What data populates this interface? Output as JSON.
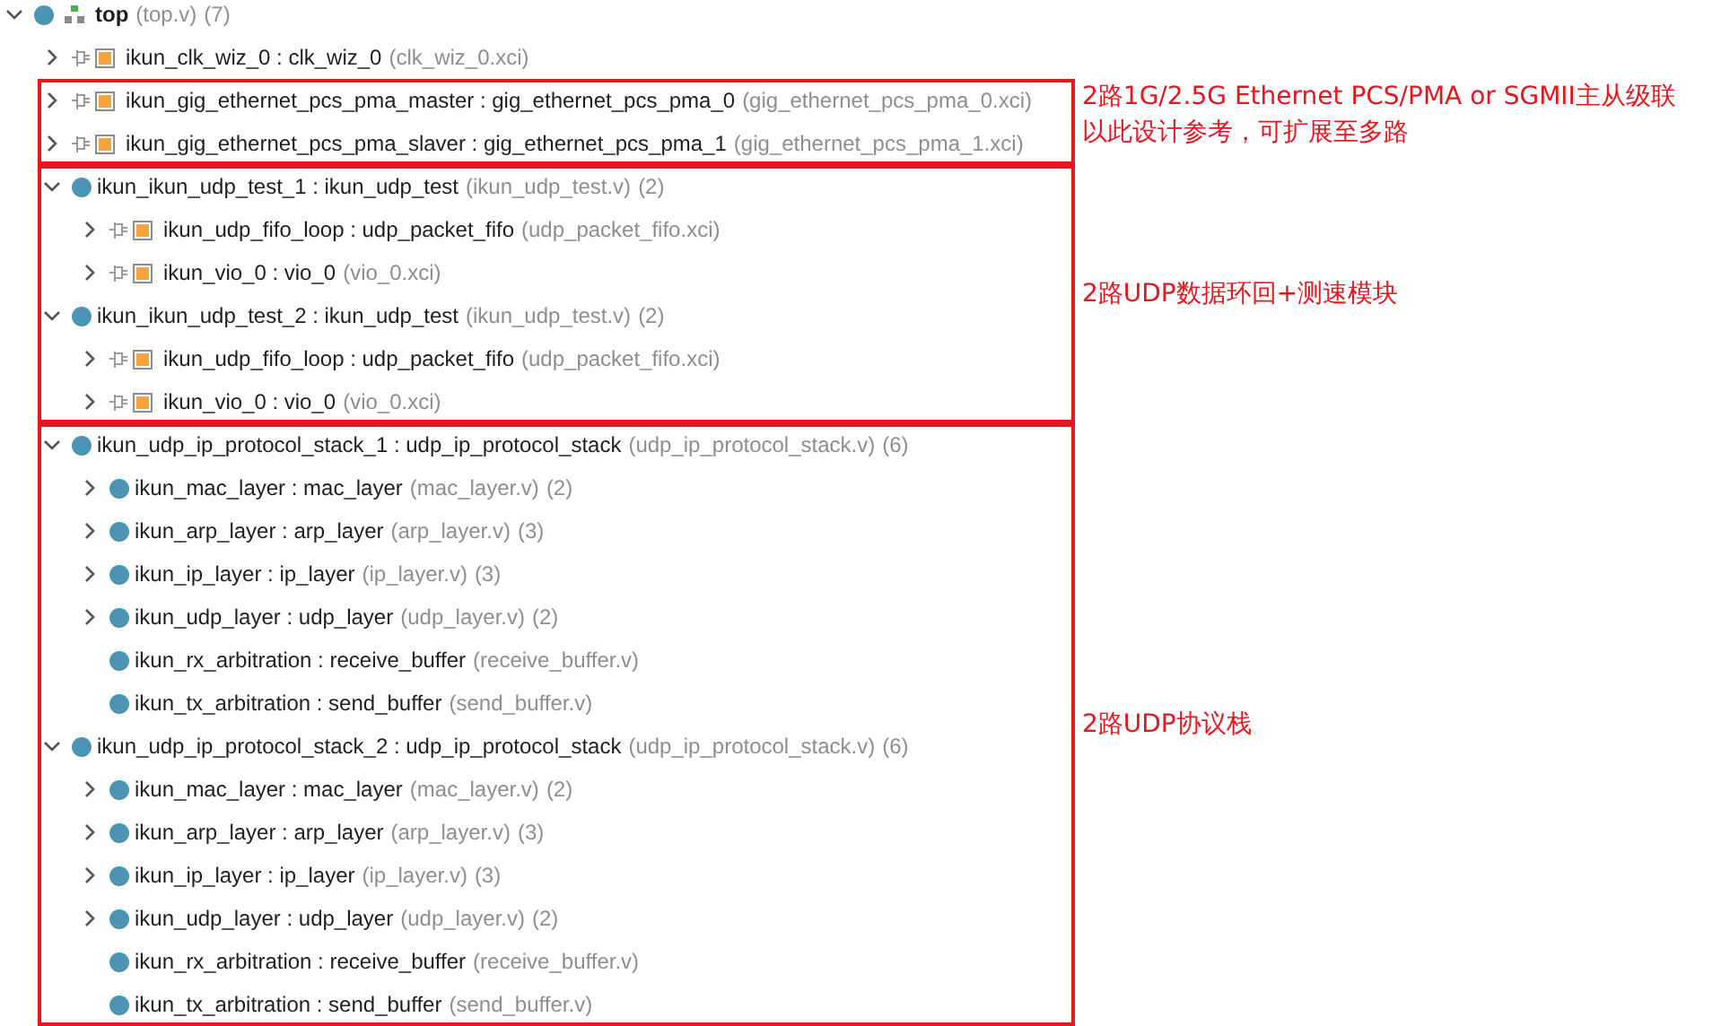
{
  "tree": {
    "kind": "module",
    "label": "top",
    "source": "(top.v)",
    "count": "(7)",
    "expanded": true,
    "groups": [
      {
        "nodes": [
          {
            "kind": "ip",
            "label": "ikun_clk_wiz_0 : clk_wiz_0",
            "source": "(clk_wiz_0.xci)",
            "expanded": false
          }
        ]
      },
      {
        "annotation": [
          "2路1G/2.5G Ethernet PCS/PMA or SGMII主从级联",
          "以此设计参考，可扩展至多路"
        ],
        "nodes": [
          {
            "kind": "ip",
            "label": "ikun_gig_ethernet_pcs_pma_master : gig_ethernet_pcs_pma_0",
            "source": "(gig_ethernet_pcs_pma_0.xci)",
            "expanded": false
          },
          {
            "kind": "ip",
            "label": "ikun_gig_ethernet_pcs_pma_slaver : gig_ethernet_pcs_pma_1",
            "source": "(gig_ethernet_pcs_pma_1.xci)",
            "expanded": false
          }
        ]
      },
      {
        "annotation": [
          "2路UDP数据环回+测速模块"
        ],
        "nodes": [
          {
            "kind": "module",
            "label": "ikun_ikun_udp_test_1 : ikun_udp_test",
            "source": "(ikun_udp_test.v)",
            "count": "(2)",
            "expanded": true,
            "children": [
              {
                "kind": "ip",
                "label": "ikun_udp_fifo_loop : udp_packet_fifo",
                "source": "(udp_packet_fifo.xci)",
                "expanded": false
              },
              {
                "kind": "ip",
                "label": "ikun_vio_0 : vio_0",
                "source": "(vio_0.xci)",
                "expanded": false
              }
            ]
          },
          {
            "kind": "module",
            "label": "ikun_ikun_udp_test_2 : ikun_udp_test",
            "source": "(ikun_udp_test.v)",
            "count": "(2)",
            "expanded": true,
            "children": [
              {
                "kind": "ip",
                "label": "ikun_udp_fifo_loop : udp_packet_fifo",
                "source": "(udp_packet_fifo.xci)",
                "expanded": false
              },
              {
                "kind": "ip",
                "label": "ikun_vio_0 : vio_0",
                "source": "(vio_0.xci)",
                "expanded": false
              }
            ]
          }
        ]
      },
      {
        "annotation": [
          "2路UDP协议栈"
        ],
        "nodes": [
          {
            "kind": "module",
            "label": "ikun_udp_ip_protocol_stack_1 : udp_ip_protocol_stack",
            "source": "(udp_ip_protocol_stack.v)",
            "count": "(6)",
            "expanded": true,
            "children": [
              {
                "kind": "module",
                "label": "ikun_mac_layer : mac_layer",
                "source": "(mac_layer.v)",
                "count": "(2)",
                "expanded": false
              },
              {
                "kind": "module",
                "label": "ikun_arp_layer : arp_layer",
                "source": "(arp_layer.v)",
                "count": "(3)",
                "expanded": false
              },
              {
                "kind": "module",
                "label": "ikun_ip_layer : ip_layer",
                "source": "(ip_layer.v)",
                "count": "(3)",
                "expanded": false
              },
              {
                "kind": "module",
                "label": "ikun_udp_layer : udp_layer",
                "source": "(udp_layer.v)",
                "count": "(2)",
                "expanded": false
              },
              {
                "kind": "module",
                "label": "ikun_rx_arbitration : receive_buffer",
                "source": "(receive_buffer.v)"
              },
              {
                "kind": "module",
                "label": "ikun_tx_arbitration : send_buffer",
                "source": "(send_buffer.v)"
              }
            ]
          },
          {
            "kind": "module",
            "label": "ikun_udp_ip_protocol_stack_2 : udp_ip_protocol_stack",
            "source": "(udp_ip_protocol_stack.v)",
            "count": "(6)",
            "expanded": true,
            "children": [
              {
                "kind": "module",
                "label": "ikun_mac_layer : mac_layer",
                "source": "(mac_layer.v)",
                "count": "(2)",
                "expanded": false
              },
              {
                "kind": "module",
                "label": "ikun_arp_layer : arp_layer",
                "source": "(arp_layer.v)",
                "count": "(3)",
                "expanded": false
              },
              {
                "kind": "module",
                "label": "ikun_ip_layer : ip_layer",
                "source": "(ip_layer.v)",
                "count": "(3)",
                "expanded": false
              },
              {
                "kind": "module",
                "label": "ikun_udp_layer : udp_layer",
                "source": "(udp_layer.v)",
                "count": "(2)",
                "expanded": false
              },
              {
                "kind": "module",
                "label": "ikun_rx_arbitration : receive_buffer",
                "source": "(receive_buffer.v)"
              },
              {
                "kind": "module",
                "label": "ikun_tx_arbitration : send_buffer",
                "source": "(send_buffer.v)"
              }
            ]
          }
        ]
      }
    ]
  }
}
